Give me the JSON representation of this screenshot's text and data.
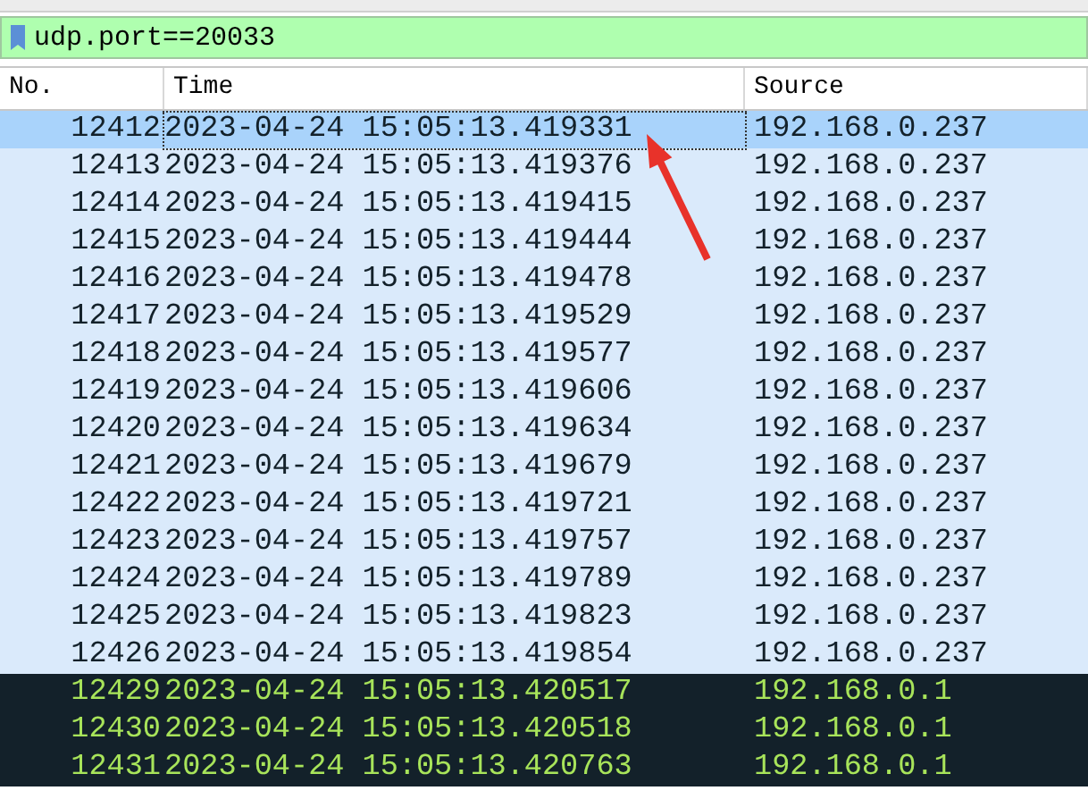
{
  "filter": {
    "value": "udp.port==20033"
  },
  "columns": [
    "No.",
    "Time",
    "Source"
  ],
  "rows": [
    {
      "no": "12412",
      "time": "2023-04-24 15:05:13.419331",
      "source": "192.168.0.237",
      "kind": "light",
      "selected": true
    },
    {
      "no": "12413",
      "time": "2023-04-24 15:05:13.419376",
      "source": "192.168.0.237",
      "kind": "light",
      "selected": false
    },
    {
      "no": "12414",
      "time": "2023-04-24 15:05:13.419415",
      "source": "192.168.0.237",
      "kind": "light",
      "selected": false
    },
    {
      "no": "12415",
      "time": "2023-04-24 15:05:13.419444",
      "source": "192.168.0.237",
      "kind": "light",
      "selected": false
    },
    {
      "no": "12416",
      "time": "2023-04-24 15:05:13.419478",
      "source": "192.168.0.237",
      "kind": "light",
      "selected": false
    },
    {
      "no": "12417",
      "time": "2023-04-24 15:05:13.419529",
      "source": "192.168.0.237",
      "kind": "light",
      "selected": false
    },
    {
      "no": "12418",
      "time": "2023-04-24 15:05:13.419577",
      "source": "192.168.0.237",
      "kind": "light",
      "selected": false
    },
    {
      "no": "12419",
      "time": "2023-04-24 15:05:13.419606",
      "source": "192.168.0.237",
      "kind": "light",
      "selected": false
    },
    {
      "no": "12420",
      "time": "2023-04-24 15:05:13.419634",
      "source": "192.168.0.237",
      "kind": "light",
      "selected": false
    },
    {
      "no": "12421",
      "time": "2023-04-24 15:05:13.419679",
      "source": "192.168.0.237",
      "kind": "light",
      "selected": false
    },
    {
      "no": "12422",
      "time": "2023-04-24 15:05:13.419721",
      "source": "192.168.0.237",
      "kind": "light",
      "selected": false
    },
    {
      "no": "12423",
      "time": "2023-04-24 15:05:13.419757",
      "source": "192.168.0.237",
      "kind": "light",
      "selected": false
    },
    {
      "no": "12424",
      "time": "2023-04-24 15:05:13.419789",
      "source": "192.168.0.237",
      "kind": "light",
      "selected": false
    },
    {
      "no": "12425",
      "time": "2023-04-24 15:05:13.419823",
      "source": "192.168.0.237",
      "kind": "light",
      "selected": false
    },
    {
      "no": "12426",
      "time": "2023-04-24 15:05:13.419854",
      "source": "192.168.0.237",
      "kind": "light",
      "selected": false
    },
    {
      "no": "12429",
      "time": "2023-04-24 15:05:13.420517",
      "source": "192.168.0.1",
      "kind": "dark",
      "selected": false
    },
    {
      "no": "12430",
      "time": "2023-04-24 15:05:13.420518",
      "source": "192.168.0.1",
      "kind": "dark",
      "selected": false
    },
    {
      "no": "12431",
      "time": "2023-04-24 15:05:13.420763",
      "source": "192.168.0.1",
      "kind": "dark",
      "selected": false
    }
  ]
}
